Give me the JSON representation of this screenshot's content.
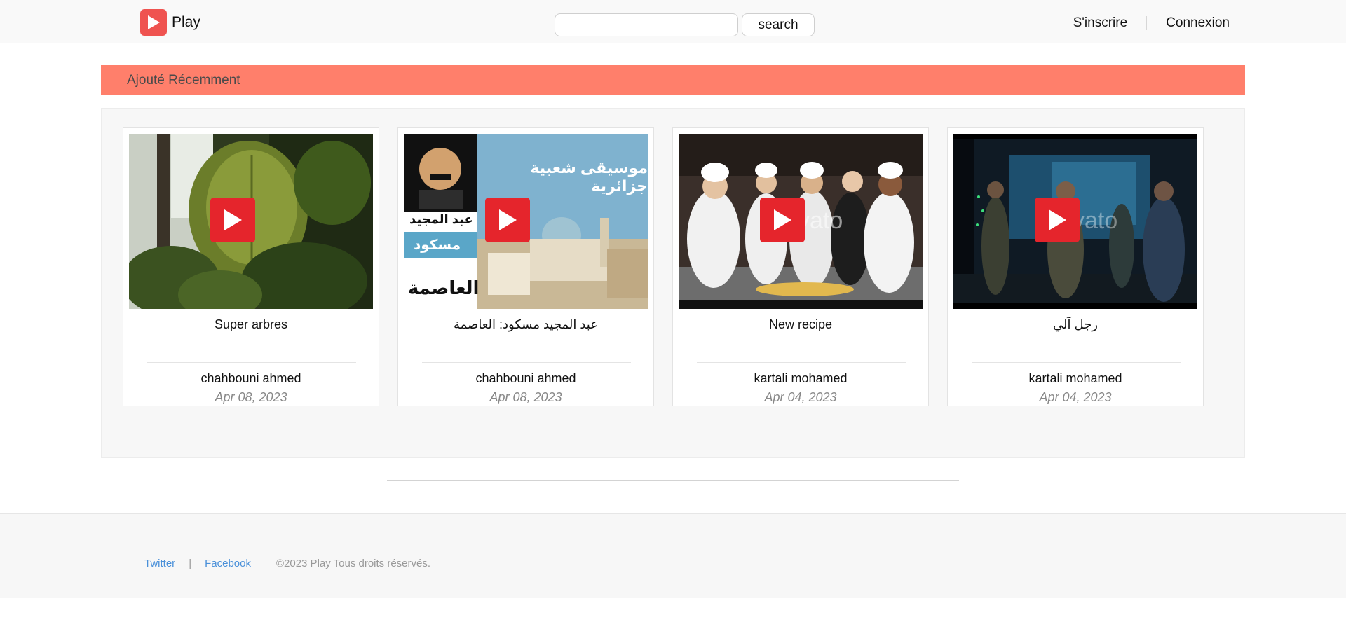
{
  "header": {
    "brand": "Play",
    "search_placeholder": "",
    "search_button": "search",
    "signup": "S'inscrire",
    "login": "Connexion"
  },
  "section": {
    "title": "Ajouté Récemment"
  },
  "videos": [
    {
      "title": "Super arbres",
      "author": "chahbouni ahmed",
      "date": "Apr 08, 2023"
    },
    {
      "title": "عبد المجيد مسكود: العاصمة",
      "author": "chahbouni ahmed",
      "date": "Apr 08, 2023",
      "thumb_text": {
        "top": "موسيقى شعبية جزائرية",
        "name1": "عبد المجيد",
        "name2": "مسكود",
        "name3": "العاصمة"
      }
    },
    {
      "title": "New recipe",
      "author": "kartali mohamed",
      "date": "Apr 04, 2023",
      "watermark": "vato"
    },
    {
      "title": "رجل آلي",
      "author": "kartali mohamed",
      "date": "Apr 04, 2023",
      "watermark": "vato"
    }
  ],
  "footer": {
    "twitter": "Twitter",
    "separator": "|",
    "facebook": "Facebook",
    "copyright": "©2023 Play Tous droits réservés."
  },
  "colors": {
    "brand_red": "#ef5350",
    "play_red": "#e5252c",
    "section_bar": "#ff7f6b",
    "link_blue": "#4a90d9"
  },
  "icons": {
    "logo": "play-logo-icon",
    "thumbnail_overlay": "play-icon"
  }
}
